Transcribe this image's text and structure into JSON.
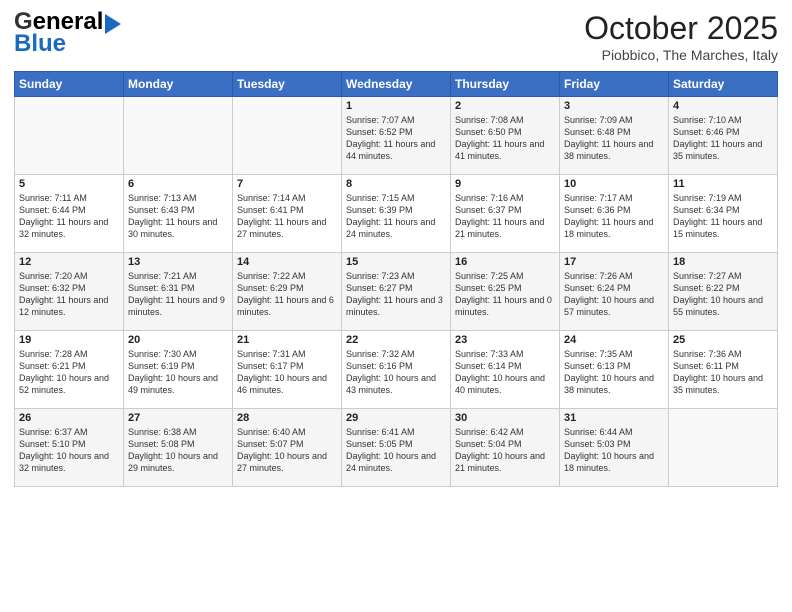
{
  "header": {
    "logo_general": "General",
    "logo_blue": "Blue",
    "month": "October 2025",
    "location": "Piobbico, The Marches, Italy"
  },
  "days_of_week": [
    "Sunday",
    "Monday",
    "Tuesday",
    "Wednesday",
    "Thursday",
    "Friday",
    "Saturday"
  ],
  "weeks": [
    {
      "cells": [
        {
          "day": "",
          "info": ""
        },
        {
          "day": "",
          "info": ""
        },
        {
          "day": "",
          "info": ""
        },
        {
          "day": "1",
          "info": "Sunrise: 7:07 AM\nSunset: 6:52 PM\nDaylight: 11 hours and 44 minutes."
        },
        {
          "day": "2",
          "info": "Sunrise: 7:08 AM\nSunset: 6:50 PM\nDaylight: 11 hours and 41 minutes."
        },
        {
          "day": "3",
          "info": "Sunrise: 7:09 AM\nSunset: 6:48 PM\nDaylight: 11 hours and 38 minutes."
        },
        {
          "day": "4",
          "info": "Sunrise: 7:10 AM\nSunset: 6:46 PM\nDaylight: 11 hours and 35 minutes."
        }
      ]
    },
    {
      "cells": [
        {
          "day": "5",
          "info": "Sunrise: 7:11 AM\nSunset: 6:44 PM\nDaylight: 11 hours and 32 minutes."
        },
        {
          "day": "6",
          "info": "Sunrise: 7:13 AM\nSunset: 6:43 PM\nDaylight: 11 hours and 30 minutes."
        },
        {
          "day": "7",
          "info": "Sunrise: 7:14 AM\nSunset: 6:41 PM\nDaylight: 11 hours and 27 minutes."
        },
        {
          "day": "8",
          "info": "Sunrise: 7:15 AM\nSunset: 6:39 PM\nDaylight: 11 hours and 24 minutes."
        },
        {
          "day": "9",
          "info": "Sunrise: 7:16 AM\nSunset: 6:37 PM\nDaylight: 11 hours and 21 minutes."
        },
        {
          "day": "10",
          "info": "Sunrise: 7:17 AM\nSunset: 6:36 PM\nDaylight: 11 hours and 18 minutes."
        },
        {
          "day": "11",
          "info": "Sunrise: 7:19 AM\nSunset: 6:34 PM\nDaylight: 11 hours and 15 minutes."
        }
      ]
    },
    {
      "cells": [
        {
          "day": "12",
          "info": "Sunrise: 7:20 AM\nSunset: 6:32 PM\nDaylight: 11 hours and 12 minutes."
        },
        {
          "day": "13",
          "info": "Sunrise: 7:21 AM\nSunset: 6:31 PM\nDaylight: 11 hours and 9 minutes."
        },
        {
          "day": "14",
          "info": "Sunrise: 7:22 AM\nSunset: 6:29 PM\nDaylight: 11 hours and 6 minutes."
        },
        {
          "day": "15",
          "info": "Sunrise: 7:23 AM\nSunset: 6:27 PM\nDaylight: 11 hours and 3 minutes."
        },
        {
          "day": "16",
          "info": "Sunrise: 7:25 AM\nSunset: 6:25 PM\nDaylight: 11 hours and 0 minutes."
        },
        {
          "day": "17",
          "info": "Sunrise: 7:26 AM\nSunset: 6:24 PM\nDaylight: 10 hours and 57 minutes."
        },
        {
          "day": "18",
          "info": "Sunrise: 7:27 AM\nSunset: 6:22 PM\nDaylight: 10 hours and 55 minutes."
        }
      ]
    },
    {
      "cells": [
        {
          "day": "19",
          "info": "Sunrise: 7:28 AM\nSunset: 6:21 PM\nDaylight: 10 hours and 52 minutes."
        },
        {
          "day": "20",
          "info": "Sunrise: 7:30 AM\nSunset: 6:19 PM\nDaylight: 10 hours and 49 minutes."
        },
        {
          "day": "21",
          "info": "Sunrise: 7:31 AM\nSunset: 6:17 PM\nDaylight: 10 hours and 46 minutes."
        },
        {
          "day": "22",
          "info": "Sunrise: 7:32 AM\nSunset: 6:16 PM\nDaylight: 10 hours and 43 minutes."
        },
        {
          "day": "23",
          "info": "Sunrise: 7:33 AM\nSunset: 6:14 PM\nDaylight: 10 hours and 40 minutes."
        },
        {
          "day": "24",
          "info": "Sunrise: 7:35 AM\nSunset: 6:13 PM\nDaylight: 10 hours and 38 minutes."
        },
        {
          "day": "25",
          "info": "Sunrise: 7:36 AM\nSunset: 6:11 PM\nDaylight: 10 hours and 35 minutes."
        }
      ]
    },
    {
      "cells": [
        {
          "day": "26",
          "info": "Sunrise: 6:37 AM\nSunset: 5:10 PM\nDaylight: 10 hours and 32 minutes."
        },
        {
          "day": "27",
          "info": "Sunrise: 6:38 AM\nSunset: 5:08 PM\nDaylight: 10 hours and 29 minutes."
        },
        {
          "day": "28",
          "info": "Sunrise: 6:40 AM\nSunset: 5:07 PM\nDaylight: 10 hours and 27 minutes."
        },
        {
          "day": "29",
          "info": "Sunrise: 6:41 AM\nSunset: 5:05 PM\nDaylight: 10 hours and 24 minutes."
        },
        {
          "day": "30",
          "info": "Sunrise: 6:42 AM\nSunset: 5:04 PM\nDaylight: 10 hours and 21 minutes."
        },
        {
          "day": "31",
          "info": "Sunrise: 6:44 AM\nSunset: 5:03 PM\nDaylight: 10 hours and 18 minutes."
        },
        {
          "day": "",
          "info": ""
        }
      ]
    }
  ]
}
